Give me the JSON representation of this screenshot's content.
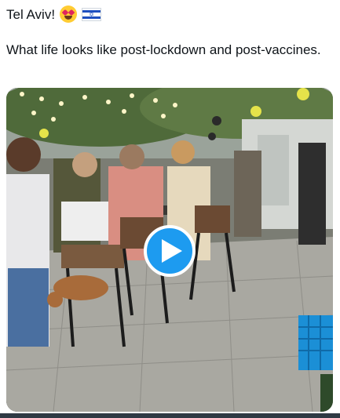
{
  "tweet": {
    "line1": "Tel Aviv!",
    "body": "What life looks like post-lockdown and post-vaccines.",
    "emojis": [
      "heart-eyes-emoji",
      "israel-flag-emoji"
    ]
  },
  "media": {
    "type": "video",
    "play_icon": "play-icon",
    "accent_color": "#1d9bf0"
  }
}
